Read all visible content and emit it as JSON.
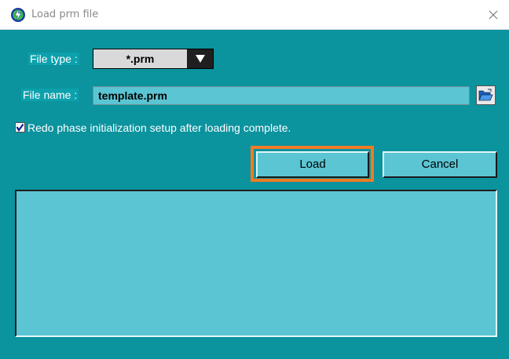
{
  "window": {
    "title": "Load prm file"
  },
  "form": {
    "file_type_label": "File type :",
    "file_type_value": "*.prm",
    "file_name_label": "File name :",
    "file_name_value": "template.prm",
    "redo_checkbox_label": "Redo phase initialization setup after loading complete.",
    "redo_checkbox_checked": true
  },
  "buttons": {
    "load": "Load",
    "cancel": "Cancel"
  },
  "colors": {
    "client_background": "#0b939e",
    "field_background": "#5bc5d3",
    "focus_outline": "#f07b24"
  },
  "icons": {
    "app": "power-bolt-icon",
    "close": "close-icon",
    "dropdown": "triangle-down-icon",
    "browse": "open-folder-icon",
    "checkbox": "checkmark-icon"
  }
}
